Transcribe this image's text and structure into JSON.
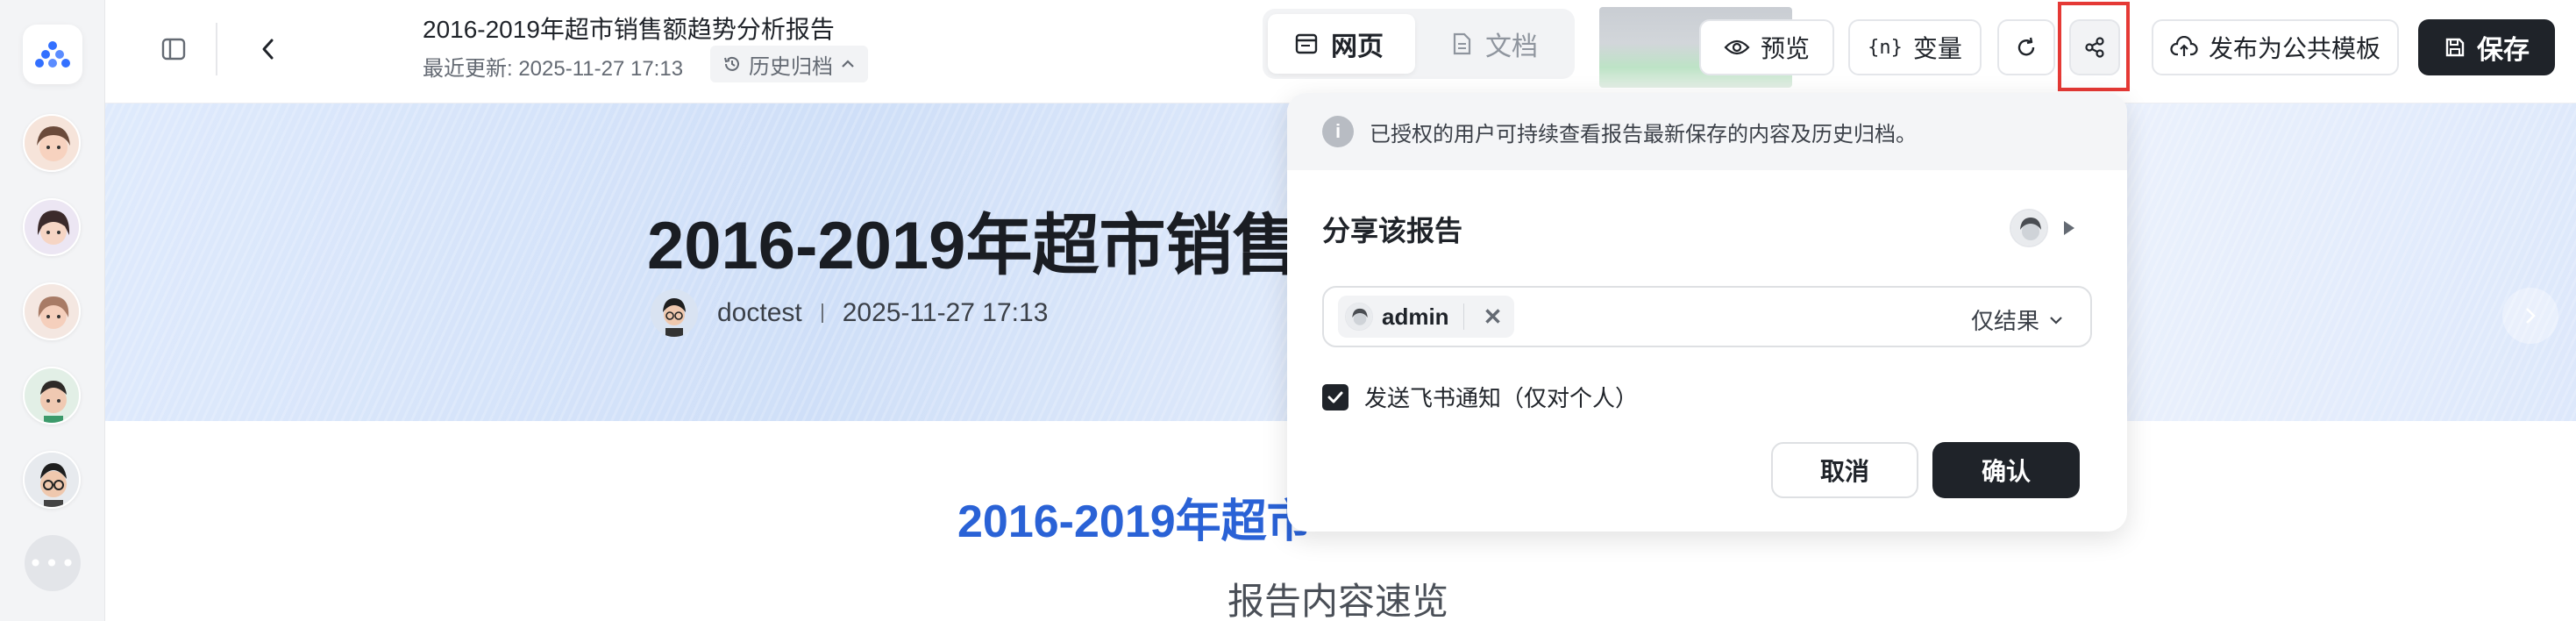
{
  "header": {
    "title": "2016-2019年超市销售额趋势分析报告",
    "last_updated": "最近更新: 2025-11-27 17:13",
    "history_label": "历史归档",
    "view_tabs": [
      {
        "label": "网页",
        "active": true
      },
      {
        "label": "文档",
        "active": false
      }
    ],
    "toolbar": {
      "preview_label": "预览",
      "variables_label": "变量",
      "variables_icon_text": "{n}",
      "publish_label": "发布为公共模板",
      "save_label": "保存"
    }
  },
  "banner": {
    "report_title": "2016-2019年超市销售",
    "author": "doctest",
    "date": "2025-11-27 17:13"
  },
  "content": {
    "heading": "2016-2019年超市",
    "subheading": "报告内容速览"
  },
  "share_popover": {
    "notice": "已授权的用户可持续查看报告最新保存的内容及历史归档。",
    "title": "分享该报告",
    "shared_user": "admin",
    "permission": "仅结果",
    "notify_label": "发送飞书通知（仅对个人）",
    "notify_checked": true,
    "cancel_label": "取消",
    "confirm_label": "确认"
  },
  "colors": {
    "accent_dark": "#1f2329",
    "heading_blue": "#2a62d6",
    "highlight_red": "#e53935",
    "logo_blue": "#3370ff"
  },
  "icons": {
    "sidebar_toggle": "sidebar-toggle-icon",
    "back": "chevron-left-icon",
    "history": "history-clock-icon",
    "web": "browser-window-icon",
    "doc": "document-icon",
    "preview": "eye-icon",
    "refresh": "refresh-icon",
    "share": "share-nodes-icon",
    "publish": "cloud-upload-icon",
    "save": "floppy-disk-icon"
  }
}
